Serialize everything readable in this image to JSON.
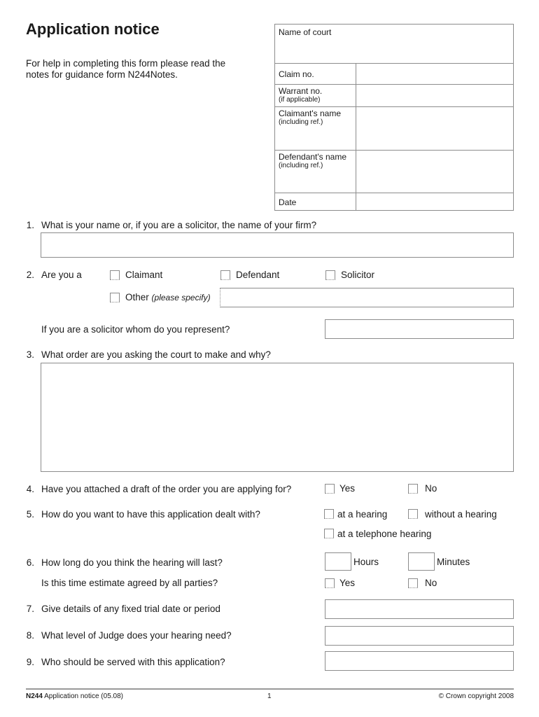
{
  "header": {
    "title": "Application notice",
    "help_text": "For help in completing this form please read the notes for guidance form N244Notes."
  },
  "court_box": {
    "name_of_court": "Name of court",
    "claim_no": "Claim no.",
    "warrant_no": "Warrant no.",
    "warrant_no_note": "(if applicable)",
    "claimants_name": "Claimant's name",
    "claimants_name_note": "(including ref.)",
    "defendants_name": "Defendant's name",
    "defendants_name_note": "(including ref.)",
    "date": "Date"
  },
  "questions": {
    "q1": {
      "num": "1.",
      "text": "What is your name or, if you are a solicitor, the name of your firm?",
      "value": ""
    },
    "q2": {
      "num": "2.",
      "text": "Are you a",
      "options": {
        "claimant": "Claimant",
        "defendant": "Defendant",
        "solicitor": "Solicitor",
        "other": "Other",
        "other_note": "(please specify)"
      },
      "other_value": "",
      "represent_text": "If you are a solicitor whom do you represent?",
      "represent_value": ""
    },
    "q3": {
      "num": "3.",
      "text": "What order are you asking the court to make and why?",
      "value": ""
    },
    "q4": {
      "num": "4.",
      "text": "Have you attached a draft of the order you are applying for?",
      "yes": "Yes",
      "no": "No"
    },
    "q5": {
      "num": "5.",
      "text": "How do you want to have this application dealt with?",
      "at_hearing": "at a hearing",
      "without_hearing": "without a hearing",
      "telephone_hearing": "at a telephone hearing"
    },
    "q6": {
      "num": "6.",
      "text": "How long do you think the hearing will last?",
      "hours": "Hours",
      "minutes": "Minutes",
      "agreed_text": "Is this time estimate agreed by all parties?",
      "yes": "Yes",
      "no": "No"
    },
    "q7": {
      "num": "7.",
      "text": "Give details of any fixed trial date or period",
      "value": ""
    },
    "q8": {
      "num": "8.",
      "text": "What level of Judge does your hearing need?",
      "value": ""
    },
    "q9": {
      "num": "9.",
      "text": "Who should be served with this application?",
      "value": ""
    }
  },
  "footer": {
    "form_code": "N244",
    "form_name": "Application notice (05.08)",
    "page": "1",
    "copyright": "© Crown copyright 2008"
  }
}
